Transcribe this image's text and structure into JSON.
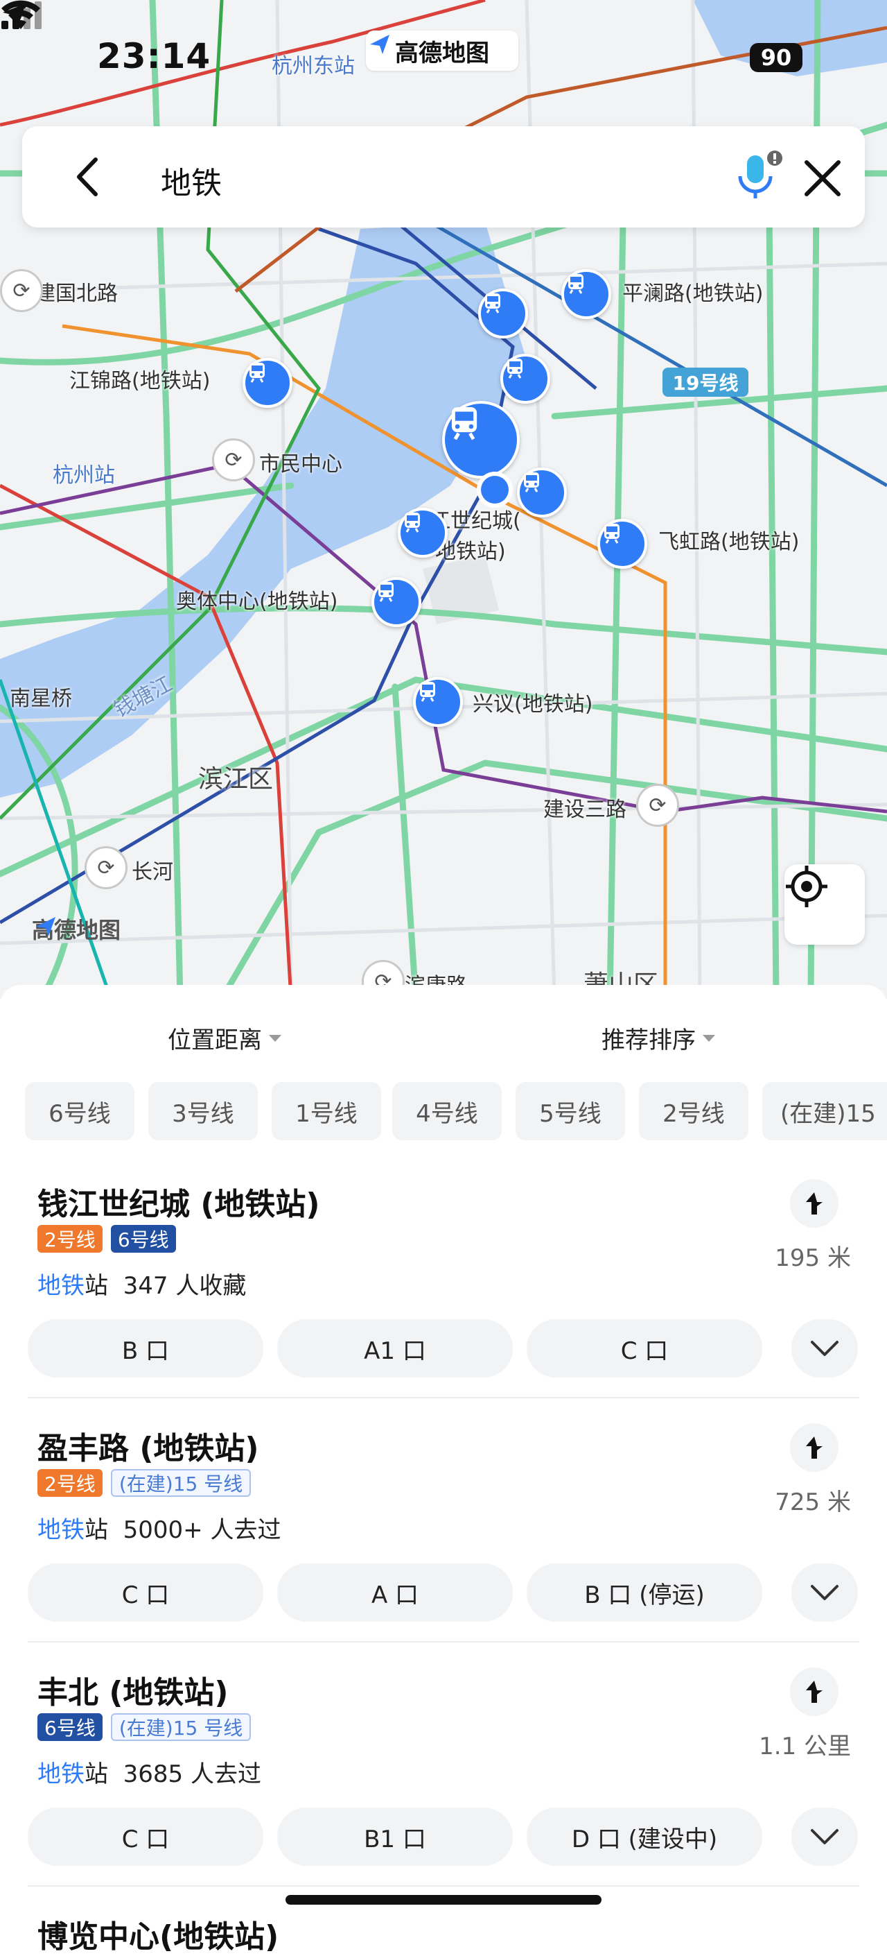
{
  "status_bar": {
    "time": "23:14",
    "app_name": "高德地图",
    "battery": "90"
  },
  "search": {
    "query": "地铁"
  },
  "map": {
    "labels": {
      "hangzhou_east": "杭州东站",
      "jianguo_north": "建国北路",
      "pinglan": "平澜路(地铁站)",
      "jiangjin": "江锦路(地铁站)",
      "line19": "19号线",
      "hangzhou_station": "杭州站",
      "shimin": "市民中心",
      "qianjiang_1": "钱江世纪城(",
      "qianjiang_2": "地铁站)",
      "feihong": "飞虹路(地铁站)",
      "aoti": "奥体中心(地铁站)",
      "nanxing": "南星桥",
      "qiantang": "钱塘江",
      "xingyi": "兴议(地铁站)",
      "binjiang": "滨江区",
      "jianshe3": "建设三路",
      "changhe": "长河",
      "watermark": "高德地图",
      "binkang": "滨康路",
      "xiaoshan": "萧山区"
    }
  },
  "sort": {
    "distance": "位置距离",
    "recommend": "推荐排序"
  },
  "chips": [
    "6号线",
    "3号线",
    "1号线",
    "4号线",
    "5号线",
    "2号线",
    "(在建)15"
  ],
  "results": [
    {
      "name": "钱江世纪城 (地铁站)",
      "tags": [
        "2号线",
        "6号线"
      ],
      "keyword": "地铁",
      "category_suffix": "站",
      "stat": "347 人收藏",
      "distance": "195 米",
      "exits": [
        "B 口",
        "A1 口",
        "C 口"
      ]
    },
    {
      "name": "盈丰路 (地铁站)",
      "tags": [
        "2号线",
        "(在建)15 号线"
      ],
      "keyword": "地铁",
      "category_suffix": "站",
      "stat": "5000+ 人去过",
      "distance": "725 米",
      "exits": [
        "C 口",
        "A 口",
        "B 口 (停运)"
      ]
    },
    {
      "name": "丰北 (地铁站)",
      "tags": [
        "6号线",
        "(在建)15 号线"
      ],
      "keyword": "地铁",
      "category_suffix": "站",
      "stat": "3685 人去过",
      "distance": "1.1 公里",
      "exits": [
        "C 口",
        "B1 口",
        "D 口 (建设中)"
      ]
    }
  ],
  "peek": "博览中心(地铁站)",
  "colors": {
    "accent": "#2f7cf6",
    "line2": "#f0782c",
    "line6": "#214fa1",
    "line19": "#43a3d6"
  }
}
